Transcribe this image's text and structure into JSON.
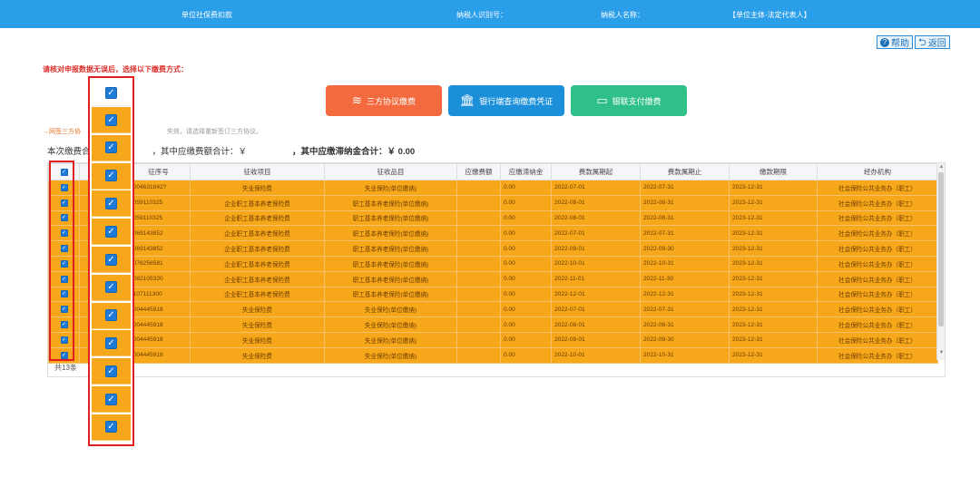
{
  "header": {
    "unit_title": "单位社保费扣款",
    "taxpayer_id_label": "纳税人识别号：",
    "taxpayer_name_label": "纳税人名称：",
    "entity_label": "【单位主体-法定代表人】"
  },
  "top_buttons": {
    "help": "帮助",
    "back": "返回"
  },
  "instruction": "请核对申报数据无误后，选择以下缴费方式：",
  "pay_methods": {
    "three_party": "三方协议缴费",
    "bank_voucher": "银行端查询缴费凭证",
    "unionpay": "银联支付缴费"
  },
  "note": {
    "link": "→网签三方协",
    "rest": "失效，请选择重新签订三方协议。"
  },
  "totals": {
    "total_label": "本次缴费合",
    "payable_label": "，其中应缴费额合计：￥",
    "late_fee_label": "，其中应缴滞纳金合计：￥ 0.00"
  },
  "table": {
    "columns": [
      "",
      "",
      "征序号",
      "征收项目",
      "征收品目",
      "应缴费额",
      "应缴滞纳金",
      "费款属期起",
      "费款属期止",
      "缴款期限",
      "经办机构"
    ],
    "rows": [
      {
        "no": "0004631842?",
        "item": "失业保险费",
        "sub": "失业保险(单位缴纳)",
        "amt": "",
        "late": "0.00",
        "start": "2022-07-01",
        "end": "2022-07-31",
        "due": "2023-12-31",
        "org": "社会保险公共业务办（职工）"
      },
      {
        "no": "0059110325",
        "item": "企业职工基本养老保险费",
        "sub": "职工基本养老保险(单位缴纳)",
        "amt": "",
        "late": "0.00",
        "start": "2022-08-01",
        "end": "2022-08-31",
        "due": "2023-12-31",
        "org": "社会保险公共业务办（职工）"
      },
      {
        "no": "0059110325",
        "item": "企业职工基本养老保险费",
        "sub": "职工基本养老保险(单位缴纳)",
        "amt": "",
        "late": "0.00",
        "start": "2022-08-01",
        "end": "2022-08-31",
        "due": "2023-12-31",
        "org": "社会保险公共业务办（职工）"
      },
      {
        "no": "0069143852",
        "item": "企业职工基本养老保险费",
        "sub": "职工基本养老保险(单位缴纳)",
        "amt": "",
        "late": "0.00",
        "start": "2022-07-01",
        "end": "2022-07-31",
        "due": "2023-12-31",
        "org": "社会保险公共业务办（职工）"
      },
      {
        "no": "0069143852",
        "item": "企业职工基本养老保险费",
        "sub": "职工基本养老保险(单位缴纳)",
        "amt": "",
        "late": "0.00",
        "start": "2022-09-01",
        "end": "2022-09-30",
        "due": "2023-12-31",
        "org": "社会保险公共业务办（职工）"
      },
      {
        "no": "0076256581",
        "item": "企业职工基本养老保险费",
        "sub": "职工基本养老保险(单位缴纳)",
        "amt": "",
        "late": "0.00",
        "start": "2022-10-01",
        "end": "2022-10-31",
        "due": "2023-12-31",
        "org": "社会保险公共业务办（职工）"
      },
      {
        "no": "0082105320",
        "item": "企业职工基本养老保险费",
        "sub": "职工基本养老保险(单位缴纳)",
        "amt": "",
        "late": "0.00",
        "start": "2022-11-01",
        "end": "2022-11-30",
        "due": "2023-12-31",
        "org": "社会保险公共业务办（职工）"
      },
      {
        "no": "0107111300",
        "item": "企业职工基本养老保险费",
        "sub": "职工基本养老保险(单位缴纳)",
        "amt": "",
        "late": "0.00",
        "start": "2022-12-01",
        "end": "2022-12-31",
        "due": "2023-12-31",
        "org": "社会保险公共业务办（职工）"
      },
      {
        "no": "0004445918",
        "item": "失业保险费",
        "sub": "失业保险(单位缴纳)",
        "amt": "",
        "late": "0.00",
        "start": "2022-07-01",
        "end": "2022-07-31",
        "due": "2023-12-31",
        "org": "社会保险公共业务办（职工）"
      },
      {
        "no": "0004445918",
        "item": "失业保险费",
        "sub": "失业保险(单位缴纳)",
        "amt": "",
        "late": "0.00",
        "start": "2022-08-01",
        "end": "2022-08-31",
        "due": "2023-12-31",
        "org": "社会保险公共业务办（职工）"
      },
      {
        "no": "0004445918",
        "item": "失业保险费",
        "sub": "失业保险(单位缴纳)",
        "amt": "",
        "late": "0.00",
        "start": "2022-09-01",
        "end": "2022-09-30",
        "due": "2023-12-31",
        "org": "社会保险公共业务办（职工）"
      },
      {
        "no": "0004445918",
        "item": "失业保险费",
        "sub": "失业保险(单位缴纳)",
        "amt": "",
        "late": "0.00",
        "start": "2022-10-01",
        "end": "2022-10-31",
        "due": "2023-12-31",
        "org": "社会保险公共业务办（职工）"
      }
    ],
    "footer": "共13条"
  },
  "colors": {
    "header_bg": "#2a9ee8",
    "row_bg": "#f7a81a",
    "btn_three_party": "#f26a3d",
    "btn_bank": "#1b8fd9",
    "btn_unionpay": "#2fc08a",
    "highlight": "#e02020"
  },
  "icons": {
    "help": "question-circle-icon",
    "back": "return-arrow-icon",
    "three_party": "layers-icon",
    "bank": "bank-building-icon",
    "unionpay": "card-icon",
    "checkbox": "checkmark-icon"
  }
}
